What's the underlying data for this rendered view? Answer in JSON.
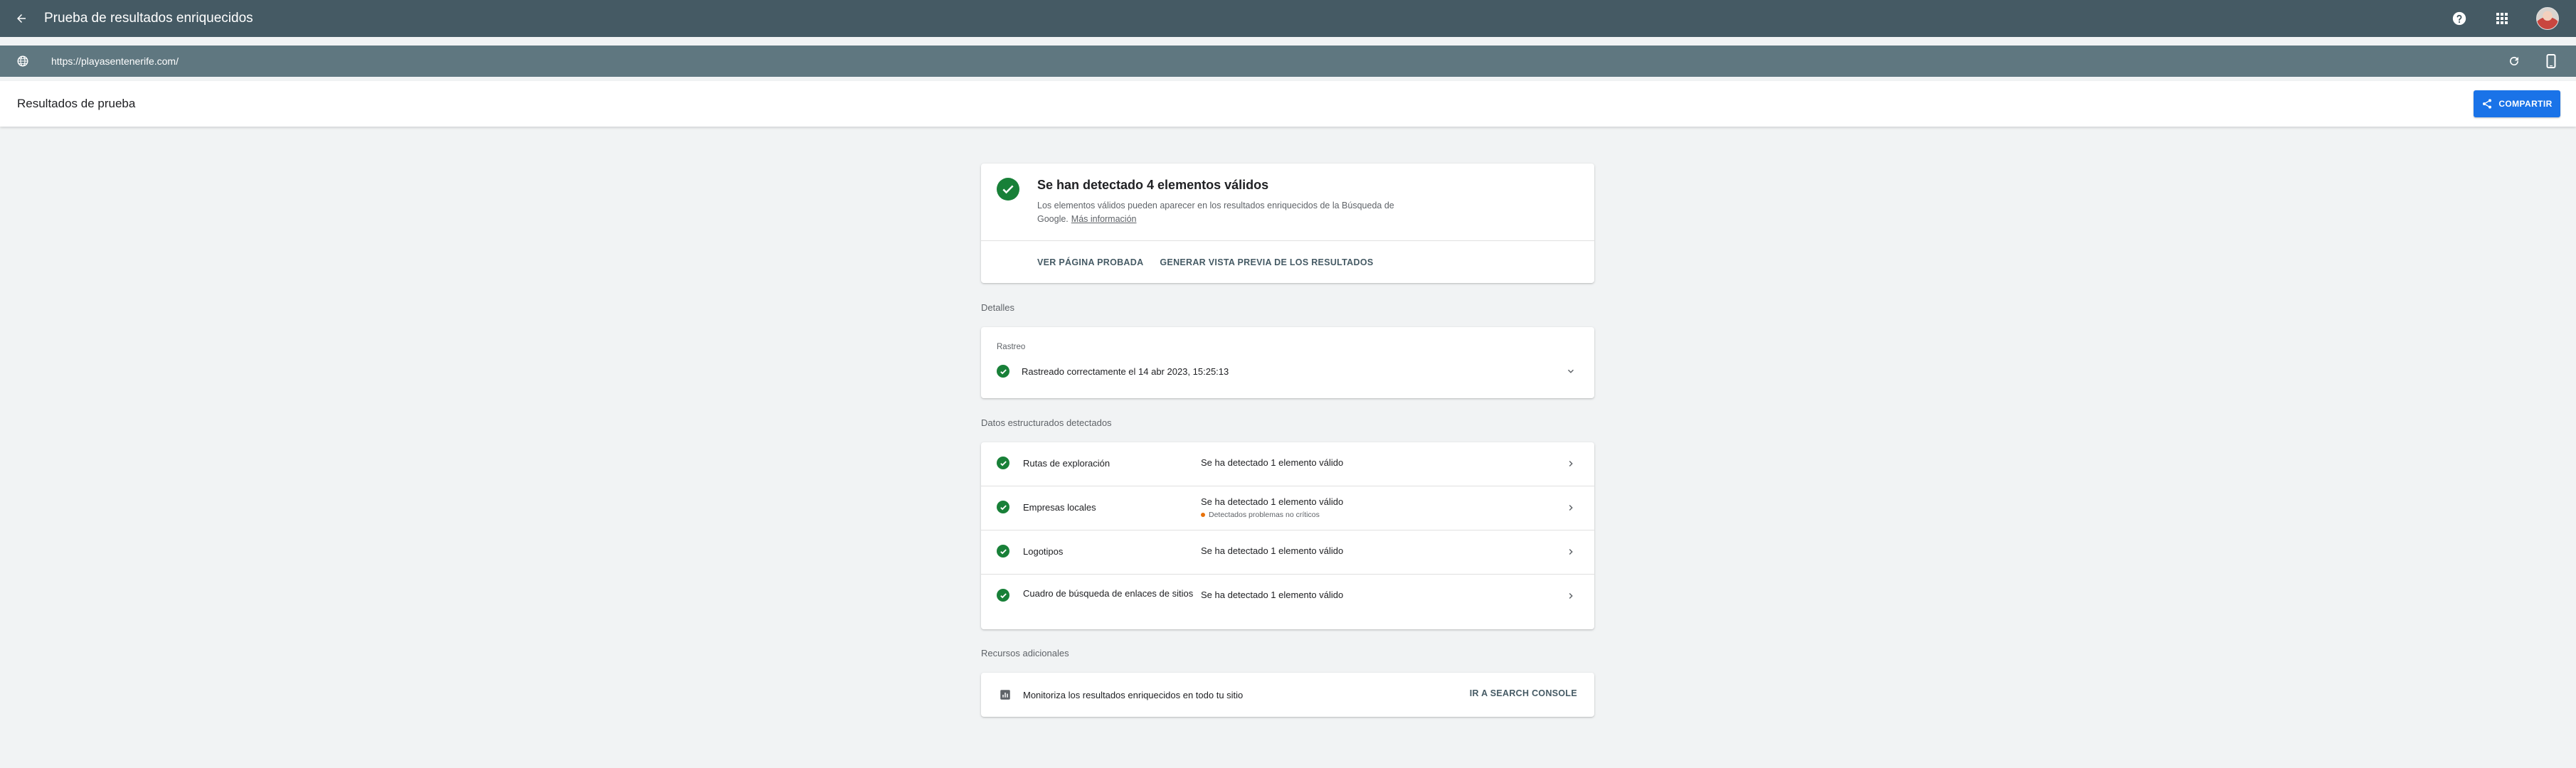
{
  "appbar": {
    "title": "Prueba de resultados enriquecidos",
    "icons": [
      "arrow-back-icon",
      "help-icon",
      "apps-grid-icon",
      "account-avatar"
    ]
  },
  "urlbar": {
    "url": "https://playasentenerife.com/",
    "icons": [
      "globe-icon",
      "refresh-icon",
      "smartphone-icon"
    ]
  },
  "header": {
    "title": "Resultados de prueba",
    "share_label": "COMPARTIR"
  },
  "summary": {
    "headline": "Se han detectado 4 elementos válidos",
    "description": "Los elementos válidos pueden aparecer en los resultados enriquecidos de la Búsqueda de Google.",
    "learn_more": "Más información",
    "view_tested_page": "VER PÁGINA PROBADA",
    "preview_results": "GENERAR VISTA PREVIA DE LOS RESULTADOS"
  },
  "details": {
    "label": "Detalles",
    "crawl_title": "Rastreo",
    "crawl_status": "Rastreado correctamente el 14 abr 2023, 15:25:13"
  },
  "structured": {
    "label": "Datos estructurados detectados",
    "rows": [
      {
        "name": "Rutas de exploración",
        "value": "Se ha detectado 1 elemento válido",
        "note": ""
      },
      {
        "name": "Empresas locales",
        "value": "Se ha detectado 1 elemento válido",
        "note": "Detectados problemas no críticos"
      },
      {
        "name": "Logotipos",
        "value": "Se ha detectado 1 elemento válido",
        "note": ""
      },
      {
        "name": "Cuadro de búsqueda de enlaces de sitios",
        "value": "Se ha detectado 1 elemento válido",
        "note": ""
      }
    ]
  },
  "resources": {
    "label": "Recursos adicionales",
    "monitor_text": "Monitoriza los resultados enriquecidos en todo tu sitio",
    "search_console_link": "IR A SEARCH CONSOLE"
  },
  "colors": {
    "appbar": "#455a64",
    "urlbar": "#5f7780",
    "accent": "#1a73e8",
    "success": "#188038",
    "warning": "#e8710a"
  }
}
